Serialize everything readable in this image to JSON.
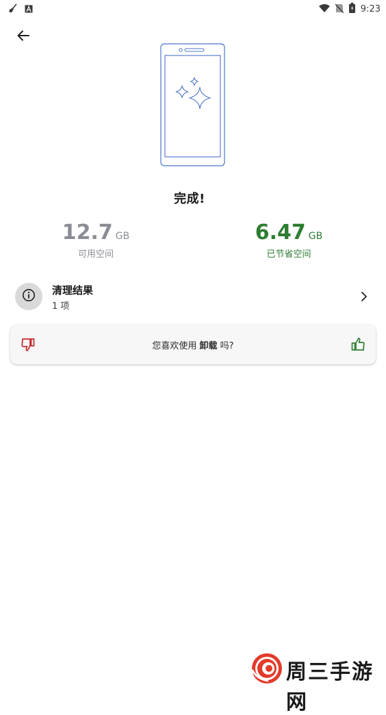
{
  "status_bar": {
    "time": "9:23",
    "left_icons": [
      "broom-icon",
      "font-a-icon"
    ],
    "right_icons": [
      "wifi-icon",
      "no-sim-icon",
      "battery-icon"
    ]
  },
  "header": {
    "back_icon": "arrow-left-icon"
  },
  "illustration": {
    "icon": "phone-sparkle-illustration",
    "color": "#4a74c9"
  },
  "title": "完成!",
  "stats": {
    "available": {
      "value": "12.7",
      "unit": "GB",
      "label": "可用空间",
      "color": "#8a8d93"
    },
    "saved": {
      "value": "6.47",
      "unit": "GB",
      "label": "已节省空间",
      "color": "#2e7d32"
    }
  },
  "result": {
    "icon": "info-icon",
    "title": "清理结果",
    "subtitle": "1 项",
    "chevron_icon": "chevron-right-icon"
  },
  "feedback": {
    "prefix": "您喜欢使用 ",
    "app_name": "卸载",
    "suffix": " 吗?",
    "thumb_down_icon": "thumbs-down-icon",
    "thumb_down_color": "#c62828",
    "thumb_up_icon": "thumbs-up-icon",
    "thumb_up_color": "#2e7d32"
  },
  "watermark": {
    "text": "周三手游网",
    "logo": "swirl-logo"
  }
}
